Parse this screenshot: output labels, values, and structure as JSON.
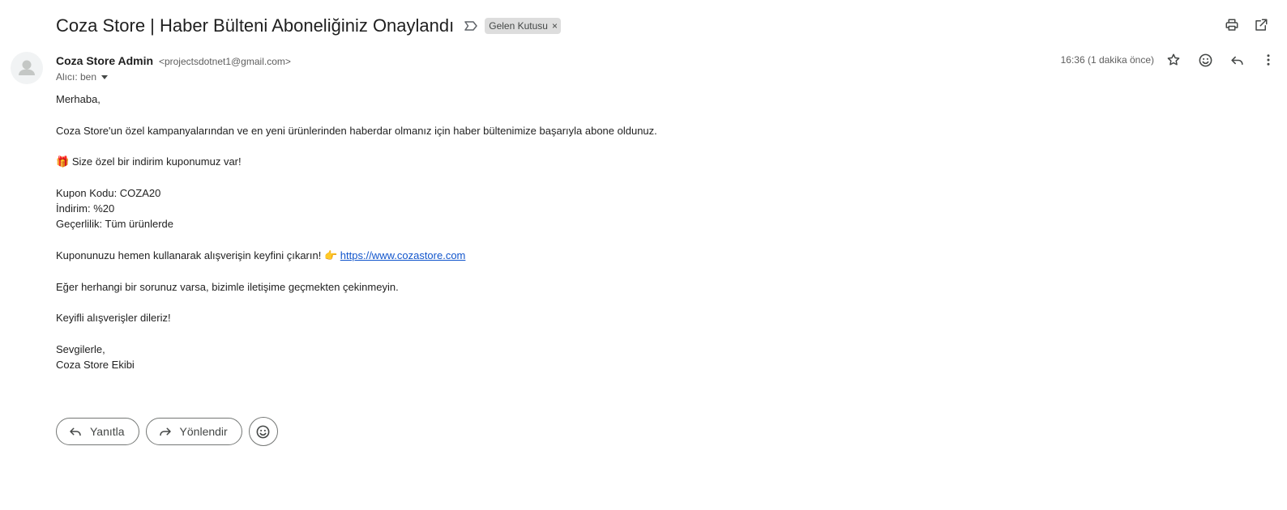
{
  "email": {
    "subject": "Coza Store | Haber Bülteni Aboneliğiniz Onaylandı",
    "label_chip": "Gelen Kutusu",
    "label_chip_close": "×",
    "sender_name": "Coza Store Admin",
    "sender_email": "<projectsdotnet1@gmail.com>",
    "recipient": "Alıcı: ben",
    "timestamp": "16:36 (1 dakika önce)",
    "body": {
      "greeting": "Merhaba,",
      "intro": "Coza Store'un özel kampanyalarından ve en yeni ürünlerinden haberdar olmanız için haber bültenimize başarıyla abone oldunuz.",
      "gift_emoji": "🎁",
      "coupon_announcement": "Size özel bir indirim kuponumuz var!",
      "coupon_code": "Kupon Kodu: COZA20",
      "discount": "İndirim: %20",
      "validity": "Geçerlilik: Tüm ürünlerde",
      "cta_text": "Kuponunuzu hemen kullanarak alışverişin keyfini çıkarın!",
      "pointing_emoji": "👉",
      "link": "https://www.cozastore.com",
      "support": "Eğer herhangi bir sorunuz varsa, bizimle iletişime geçmekten çekinmeyin.",
      "wish": "Keyifli alışverişler dileriz!",
      "closing": "Sevgilerle,",
      "signature": "Coza Store Ekibi"
    }
  },
  "actions": {
    "reply": "Yanıtla",
    "forward": "Yönlendir"
  },
  "icons": {
    "important_marker": "important-marker-icon",
    "print": "print-icon",
    "open_new_window": "open-in-new-window-icon",
    "star": "star-icon",
    "emoji": "emoji-reaction-icon",
    "reply": "reply-icon",
    "more": "more-vert-icon",
    "avatar": "avatar-person-icon"
  },
  "colors": {
    "text": "#1f1f1f",
    "muted": "#5e5e5e",
    "link": "#1155cc",
    "chip_bg": "#dddddd"
  }
}
